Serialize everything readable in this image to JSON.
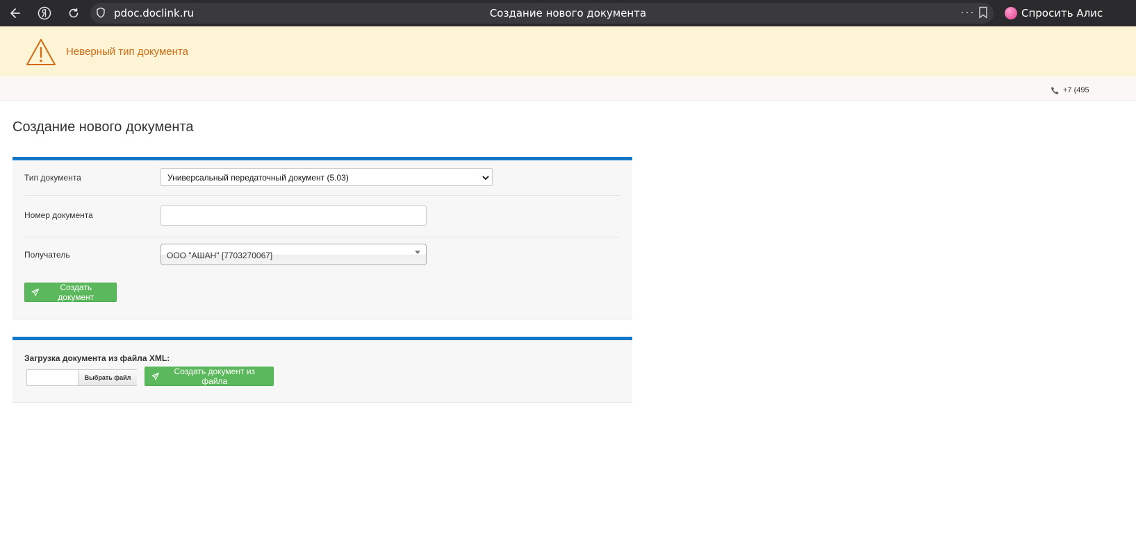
{
  "browser": {
    "url": "pdoc.doclink.ru",
    "tab_title": "Создание нового документа",
    "alice_label": "Спросить Алис",
    "icons": [
      "back-icon",
      "yandex-icon",
      "reload-icon",
      "shield-icon",
      "more-icon",
      "bookmark-icon",
      "alice-icon"
    ]
  },
  "alert": {
    "text": "Неверный тип документа",
    "icon": "warning-icon",
    "color": "#d06b16",
    "background": "#fdf3d5"
  },
  "topbar": {
    "phone": "+7 (495",
    "icon": "phone-icon"
  },
  "page": {
    "title": "Создание нового документа"
  },
  "form": {
    "doc_type_label": "Тип документа",
    "doc_type_value": "Универсальный передаточный документ (5.03)",
    "doc_number_label": "Номер документа",
    "doc_number_value": "",
    "recipient_label": "Получатель",
    "recipient_value": "ООО \"АШАН\" [7703270067]",
    "create_button": "Создать документ"
  },
  "upload": {
    "label": "Загрузка документа из файла XML:",
    "choose_file": "Выбрать файл",
    "create_button": "Создать документ из файла"
  },
  "colors": {
    "accent": "#1478c8",
    "button": "#5cb85c"
  }
}
